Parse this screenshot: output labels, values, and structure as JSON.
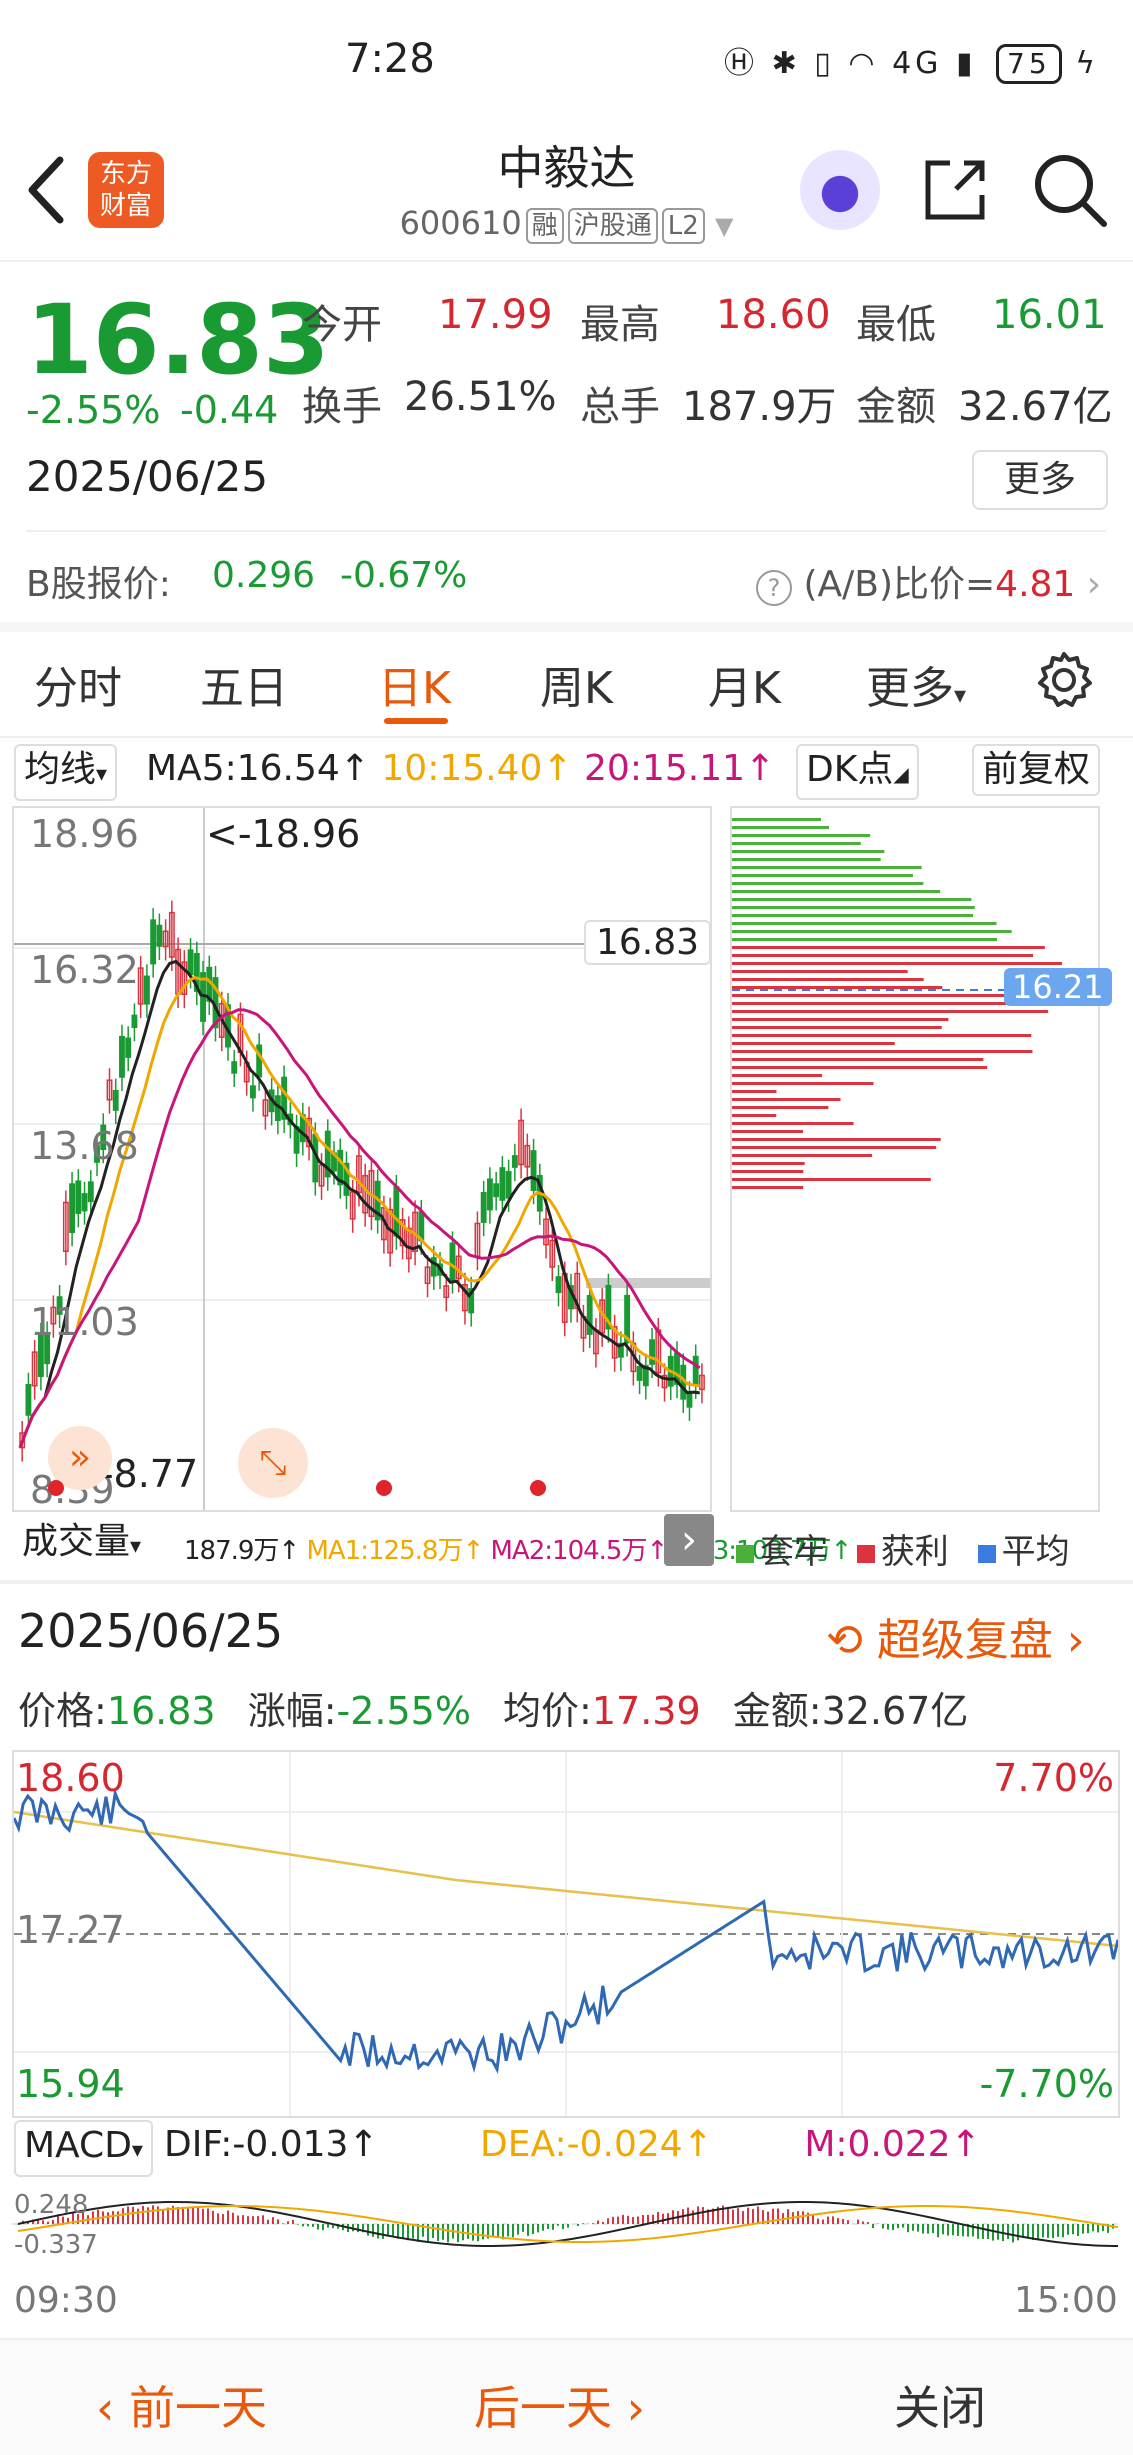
{
  "status": {
    "time": "7:28",
    "network": "4G",
    "battery": "75"
  },
  "header": {
    "name": "中毅达",
    "code": "600610",
    "tags": [
      "融",
      "沪股通",
      "L2"
    ],
    "logo_text": "东方财富"
  },
  "quote": {
    "price": "16.83",
    "pct": "-2.55%",
    "chg": "-0.44",
    "date": "2025/06/25",
    "open_label": "今开",
    "open": "17.99",
    "high_label": "最高",
    "high": "18.60",
    "low_label": "最低",
    "low": "16.01",
    "turnover_label": "换手",
    "turnover": "26.51%",
    "volume_label": "总手",
    "volume": "187.9万",
    "amount_label": "金额",
    "amount": "32.67亿",
    "more_label": "更多"
  },
  "bshare": {
    "label": "B股报价:",
    "price": "0.296",
    "pct": "-0.67%",
    "ratio_label": "(A/B)比价=",
    "ratio": "4.81"
  },
  "tabs": [
    "分时",
    "五日",
    "日K",
    "周K",
    "月K",
    "更多"
  ],
  "active_tab": 2,
  "ma": {
    "selector": "均线",
    "ma5": "MA5:16.54↑",
    "ma10": "10:15.40↑",
    "ma20": "20:15.11↑",
    "dk": "DK点",
    "adjust": "前复权",
    "colors": {
      "ma5": "#222222",
      "ma10": "#f0a800",
      "ma20": "#c8157a"
    }
  },
  "kchart": {
    "y_labels": [
      "18.96",
      "16.32",
      "13.68",
      "11.03",
      "8.39"
    ],
    "high_label": "<-18.96",
    "low_label": "<-8.77",
    "current": "16.83"
  },
  "chip": {
    "avg": "16.21",
    "legend": [
      "套牢",
      "获利",
      "平均"
    ],
    "colors": {
      "trapped": "#4caf3a",
      "profit": "#d9343f",
      "avg": "#3b7be0"
    }
  },
  "volume": {
    "selector": "成交量",
    "vol": "187.9万↑",
    "ma1": "MA1:125.8万↑",
    "ma2": "MA2:104.5万↑",
    "ma3": "MA3:103.7万↑"
  },
  "replay": {
    "date": "2025/06/25",
    "title": "超级复盘",
    "price_label": "价格:",
    "price": "16.83",
    "pct_label": "涨幅:",
    "pct": "-2.55%",
    "avg_label": "均价:",
    "avg": "17.39",
    "amount_label": "金额:",
    "amount": "32.67亿"
  },
  "intraday": {
    "y_high": "18.60",
    "y_mid": "17.27",
    "y_low": "15.94",
    "pct_high": "7.70%",
    "pct_low": "-7.70%",
    "t_start": "09:30",
    "t_end": "15:00"
  },
  "macd": {
    "selector": "MACD",
    "dif": "DIF:-0.013↑",
    "dea": "DEA:-0.024↑",
    "m": "M:0.022↑",
    "y_top": "0.248",
    "y_bot": "-0.337"
  },
  "nav": {
    "prev": "前一天",
    "next": "后一天",
    "close": "关闭"
  }
}
